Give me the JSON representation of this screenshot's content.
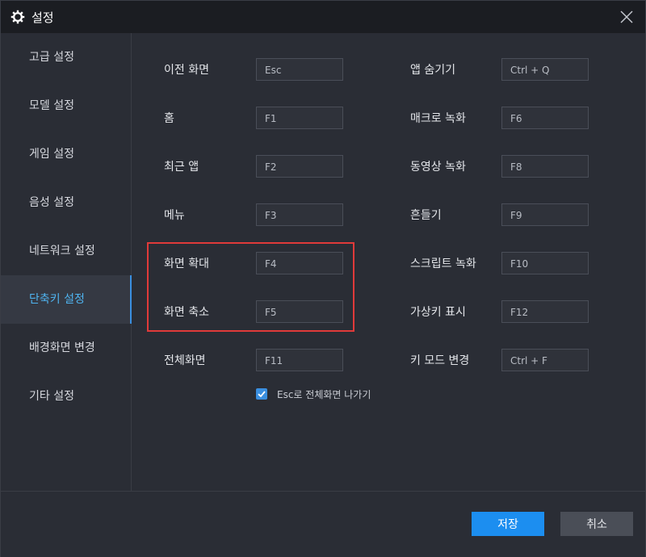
{
  "window": {
    "title": "설정",
    "icon": "gear-icon",
    "close_icon": "close-icon"
  },
  "sidebar": {
    "items": [
      {
        "label": "고급 설정",
        "active": false
      },
      {
        "label": "모델 설정",
        "active": false
      },
      {
        "label": "게임 설정",
        "active": false
      },
      {
        "label": "음성 설정",
        "active": false
      },
      {
        "label": "네트워크 설정",
        "active": false
      },
      {
        "label": "단축키 설정",
        "active": true
      },
      {
        "label": "배경화면 변경",
        "active": false
      },
      {
        "label": "기타 설정",
        "active": false
      }
    ]
  },
  "shortcuts": {
    "left": [
      {
        "label": "이전 화면",
        "key": "Esc"
      },
      {
        "label": "홈",
        "key": "F1"
      },
      {
        "label": "최근 앱",
        "key": "F2"
      },
      {
        "label": "메뉴",
        "key": "F3"
      },
      {
        "label": "화면 확대",
        "key": "F4"
      },
      {
        "label": "화면 축소",
        "key": "F5"
      },
      {
        "label": "전체화면",
        "key": "F11"
      }
    ],
    "right": [
      {
        "label": "앱 숨기기",
        "key": "Ctrl + Q"
      },
      {
        "label": "매크로 녹화",
        "key": "F6"
      },
      {
        "label": "동영상 녹화",
        "key": "F8"
      },
      {
        "label": "흔들기",
        "key": "F9"
      },
      {
        "label": "스크립트 녹화",
        "key": "F10"
      },
      {
        "label": "가상키 표시",
        "key": "F12"
      },
      {
        "label": "키 모드 변경",
        "key": "Ctrl + F"
      }
    ]
  },
  "options": {
    "esc_exit_fullscreen": {
      "label": "Esc로 전체화면 나가기",
      "checked": true
    }
  },
  "footer": {
    "save_label": "저장",
    "cancel_label": "취소"
  },
  "colors": {
    "accent": "#1c8ef0",
    "active_text": "#4fb4f0",
    "highlight_box": "#e03a3a"
  }
}
